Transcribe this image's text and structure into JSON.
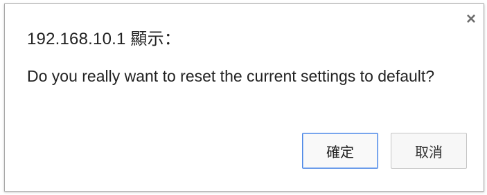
{
  "dialog": {
    "title": "192.168.10.1 顯示：",
    "message": "Do you really want to reset the current settings to default?",
    "close_icon": "close-icon",
    "buttons": {
      "ok_label": "確定",
      "cancel_label": "取消"
    },
    "colors": {
      "accent_border": "#4c87e6",
      "text": "#222222",
      "close_icon": "#6e6e6e"
    }
  }
}
